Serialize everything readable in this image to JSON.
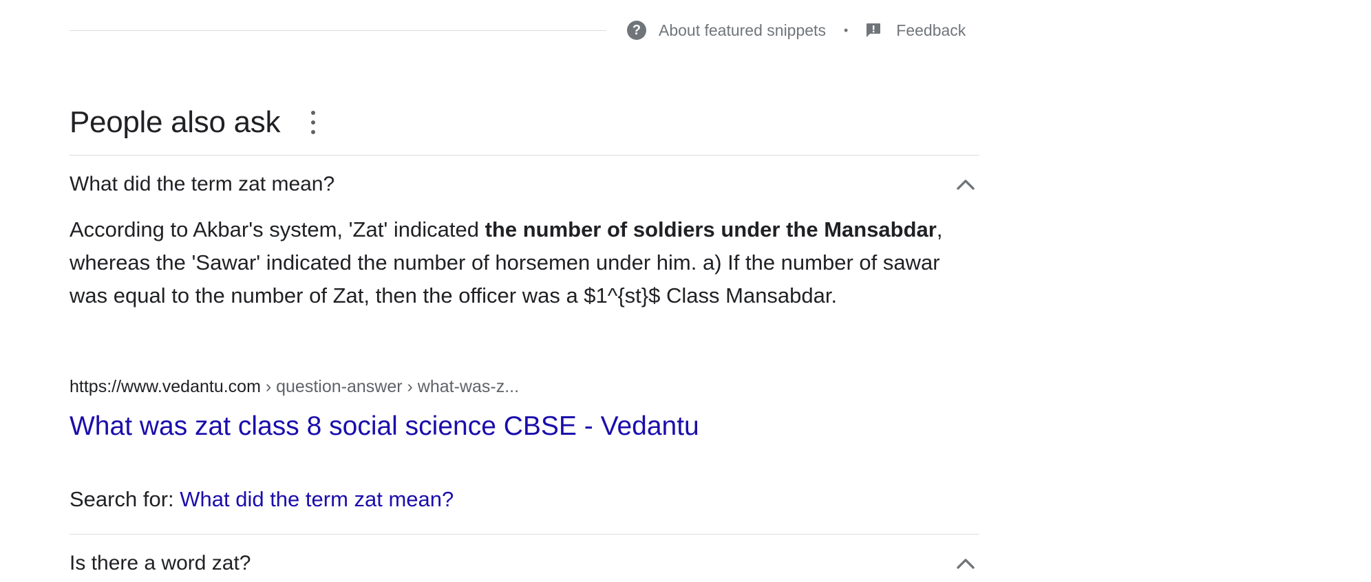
{
  "snippet_footer": {
    "about_label": "About featured snippets",
    "separator": "•",
    "feedback_label": "Feedback"
  },
  "paa": {
    "title": "People also ask",
    "questions": [
      {
        "text": "What did the term zat mean?",
        "expanded": true,
        "answer": {
          "text_before_bold": "According to Akbar's system, 'Zat' indicated ",
          "bold": "the number of soldiers under the Mansabdar",
          "text_after_bold": ", whereas the 'Sawar' indicated the number of horsemen under him. a) If the number of sawar was equal to the number of Zat, then the officer was a $1^{st}$ Class Mansabdar."
        },
        "source": {
          "domain": "https://www.vedantu.com",
          "breadcrumb": " › question-answer › what-was-z..."
        },
        "result_title": "What was zat class 8 social science CBSE - Vedantu",
        "search_for_label": "Search for: ",
        "search_for_query": "What did the term zat mean?"
      },
      {
        "text": "Is there a word zat?",
        "expanded": true
      }
    ]
  },
  "colors": {
    "link": "#1a0dab",
    "text": "#202124",
    "muted": "#70757a",
    "divider": "#dadce0"
  }
}
